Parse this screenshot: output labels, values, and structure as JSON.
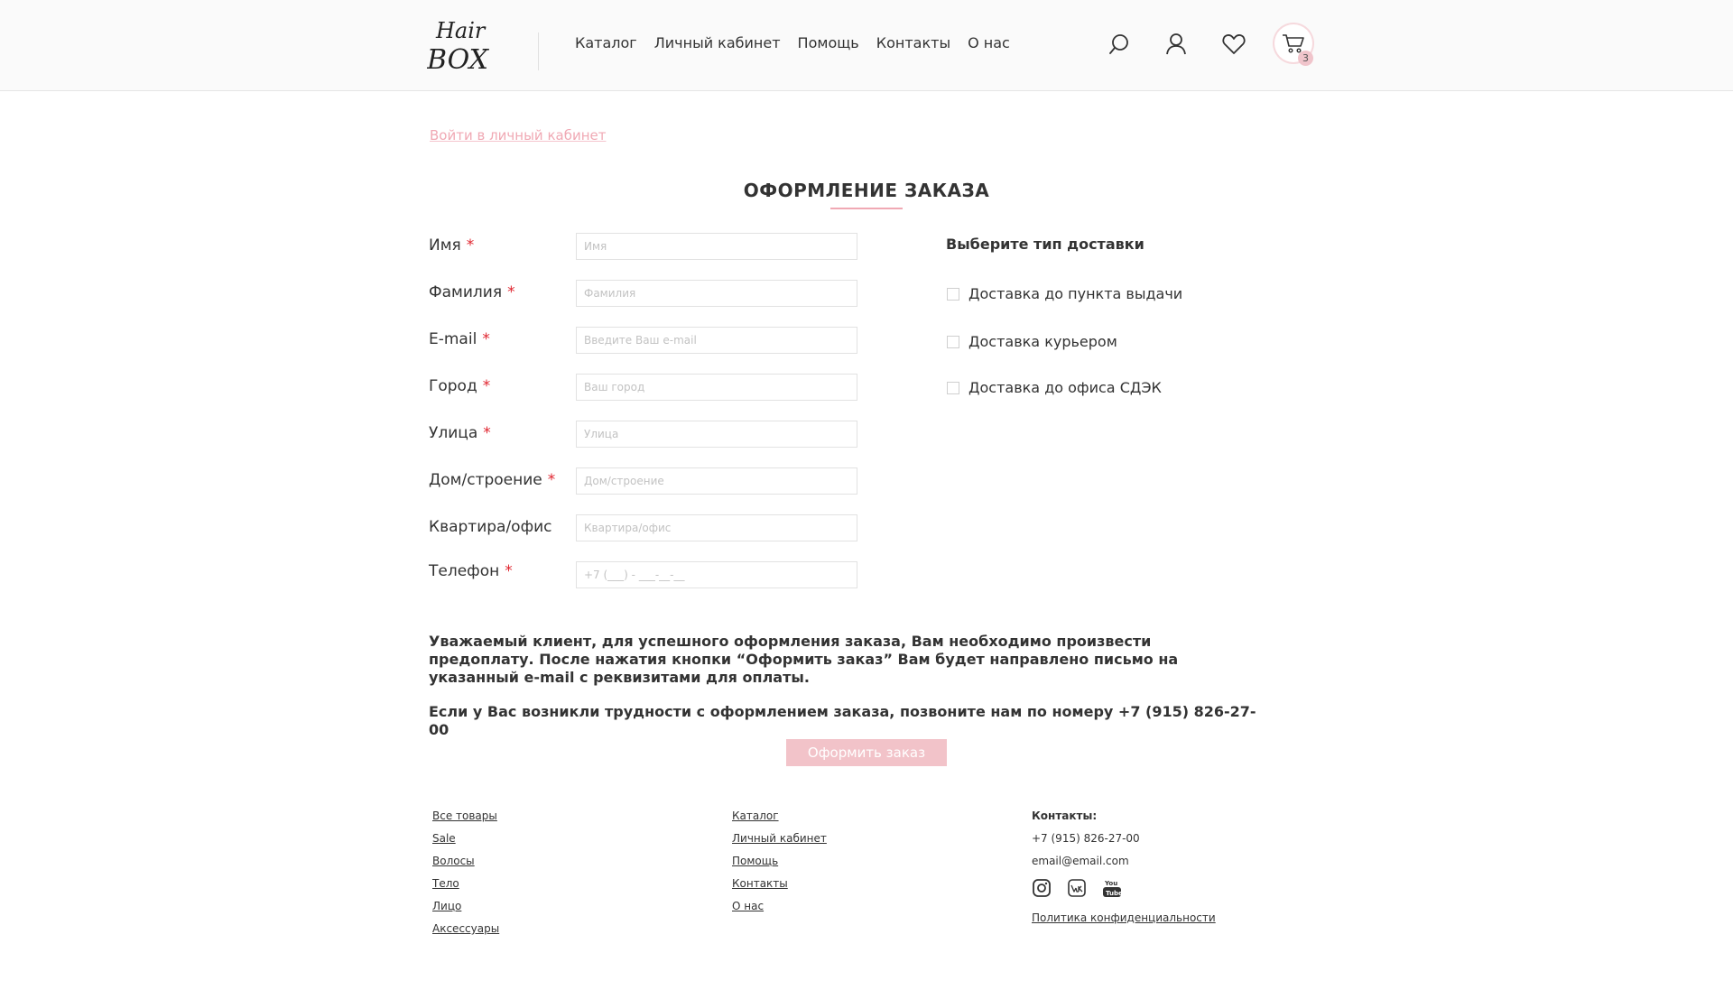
{
  "header": {
    "logo_top": "Hair",
    "logo_bottom": "BOX",
    "nav": [
      "Каталог",
      "Личный кабинет",
      "Помощь",
      "Контакты",
      "О нас"
    ],
    "cart_count": "3"
  },
  "main": {
    "login_link": "Войти в личный кабинет",
    "title": "ОФОРМЛЕНИЕ ЗАКАЗА",
    "required_mark": "*",
    "fields": [
      {
        "label": "Имя",
        "placeholder": "Имя",
        "required": true
      },
      {
        "label": "Фамилия",
        "placeholder": "Фамилия",
        "required": true
      },
      {
        "label": "E-mail",
        "placeholder": "Введите Ваш e-mail",
        "required": true
      },
      {
        "label": "Город",
        "placeholder": "Ваш город",
        "required": true
      },
      {
        "label": "Улица",
        "placeholder": "Улица",
        "required": true
      },
      {
        "label": "Дом/строение",
        "placeholder": "Дом/строение",
        "required": true
      },
      {
        "label": "Квартира/офис",
        "placeholder": "Квартира/офис",
        "required": false
      },
      {
        "label": "Телефон",
        "placeholder": "+7 (___) - ___-__-__",
        "required": true
      }
    ],
    "delivery": {
      "title": "Выберите тип доставки",
      "options": [
        "Доставка до пункта выдачи",
        "Доставка курьером",
        "Доставка до офиса СДЭК"
      ]
    },
    "notice_1": "Уважаемый клиент, для успешного оформления заказа, Вам необходимо произвести предоплату. После нажатия кнопки “Оформить заказ” Вам будет направлено письмо на указанный e-mail с реквизитами для оплаты.",
    "notice_2": "Если у Вас возникли трудности с оформлением заказа, позвоните нам по номеру +7 (915) 826-27-00",
    "submit": "Оформить заказ"
  },
  "footer": {
    "col1": [
      "Все товары",
      "Sale",
      "Волосы",
      "Тело",
      "Лицо",
      "Аксессуары"
    ],
    "col2": [
      "Каталог",
      "Личный кабинет",
      "Помощь",
      "Контакты",
      "О нас"
    ],
    "contacts_title": "Контакты:",
    "phone": "+7 (915) 826-27-00",
    "email": "email@email.com",
    "social": [
      "instagram-icon",
      "vk-icon",
      "youtube-icon"
    ],
    "privacy": "Политика конфиденциальности"
  },
  "colors": {
    "accent": "#f0a9b4",
    "button": "#f2c3c9",
    "required": "#e0252f"
  }
}
